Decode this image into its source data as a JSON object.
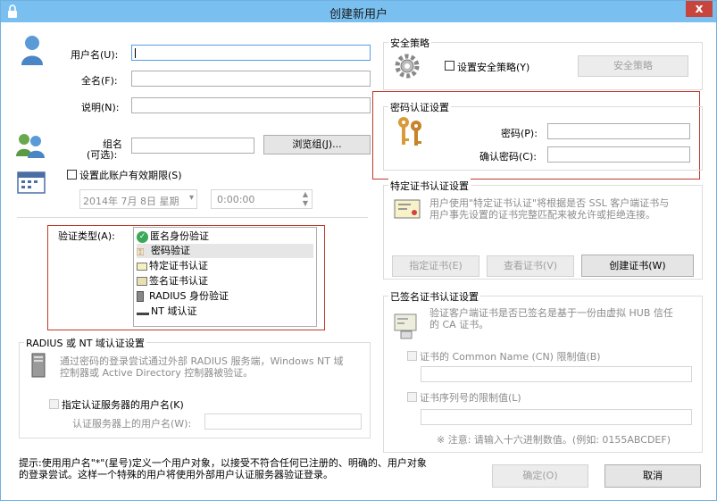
{
  "window": {
    "title": "创建新用户",
    "close_glyph": "x"
  },
  "user": {
    "username_label": "用户名(U):",
    "fullname_label": "全名(F):",
    "description_label": "说明(N):",
    "group_label_line1": "组名",
    "group_label_line2": "(可选):",
    "browse_group_button": "浏览组(J)...",
    "expiry_checkbox_label": "设置此账户有效期限(S)",
    "date_value": "2014年 7月 8日 星期",
    "time_value": "0:00:00"
  },
  "auth": {
    "type_label": "验证类型(A):",
    "options": [
      "匿名身份验证",
      "密码验证",
      "特定证书认证",
      "签名证书认证",
      "RADIUS 身份验证",
      "NT 域认证"
    ]
  },
  "radius": {
    "group_title": "RADIUS 或 NT 域认证设置",
    "desc": "通过密码的登录尝试通过外部 RADIUS 服务端，Windows NT 域\n控制器或 Active Directory 控制器被验证。",
    "checkbox_label": "指定认证服务器的用户名(K)",
    "server_user_label": "认证服务器上的用户名(W):"
  },
  "security": {
    "group_title": "安全策略",
    "checkbox_label": "设置安全策略(Y)",
    "button": "安全策略"
  },
  "password": {
    "group_title": "密码认证设置",
    "password_label": "密码(P):",
    "confirm_label": "确认密码(C):"
  },
  "cert": {
    "group_title": "特定证书认证设置",
    "desc": "用户使用\"特定证书认证\"将根据是否 SSL 客户端证书与\n用户事先设置的证书完整匹配来被允许或拒绝连接。",
    "specify_button": "指定证书(E)",
    "view_button": "查看证书(V)",
    "create_button": "创建证书(W)"
  },
  "signed": {
    "group_title": "已签名证书认证设置",
    "desc": "验证客户端证书是否已签名是基于一份由虚拟 HUB 信任\n的 CA 证书。",
    "cn_checkbox_label": "证书的 Common Name (CN) 限制值(B)",
    "serial_checkbox_label": "证书序列号的限制值(L)",
    "note": "※ 注意: 请输入十六进制数值。(例如: 0155ABCDEF)"
  },
  "footer": {
    "hint": "提示:使用用户名\"*\"(星号)定义一个用户对象，以接受不符合任何已注册的、明确的、用户对象\n的登录尝试。这样一个特殊的用户将使用外部用户认证服务器验证登录。",
    "ok_button": "确定(O)",
    "cancel_button": "取消"
  }
}
